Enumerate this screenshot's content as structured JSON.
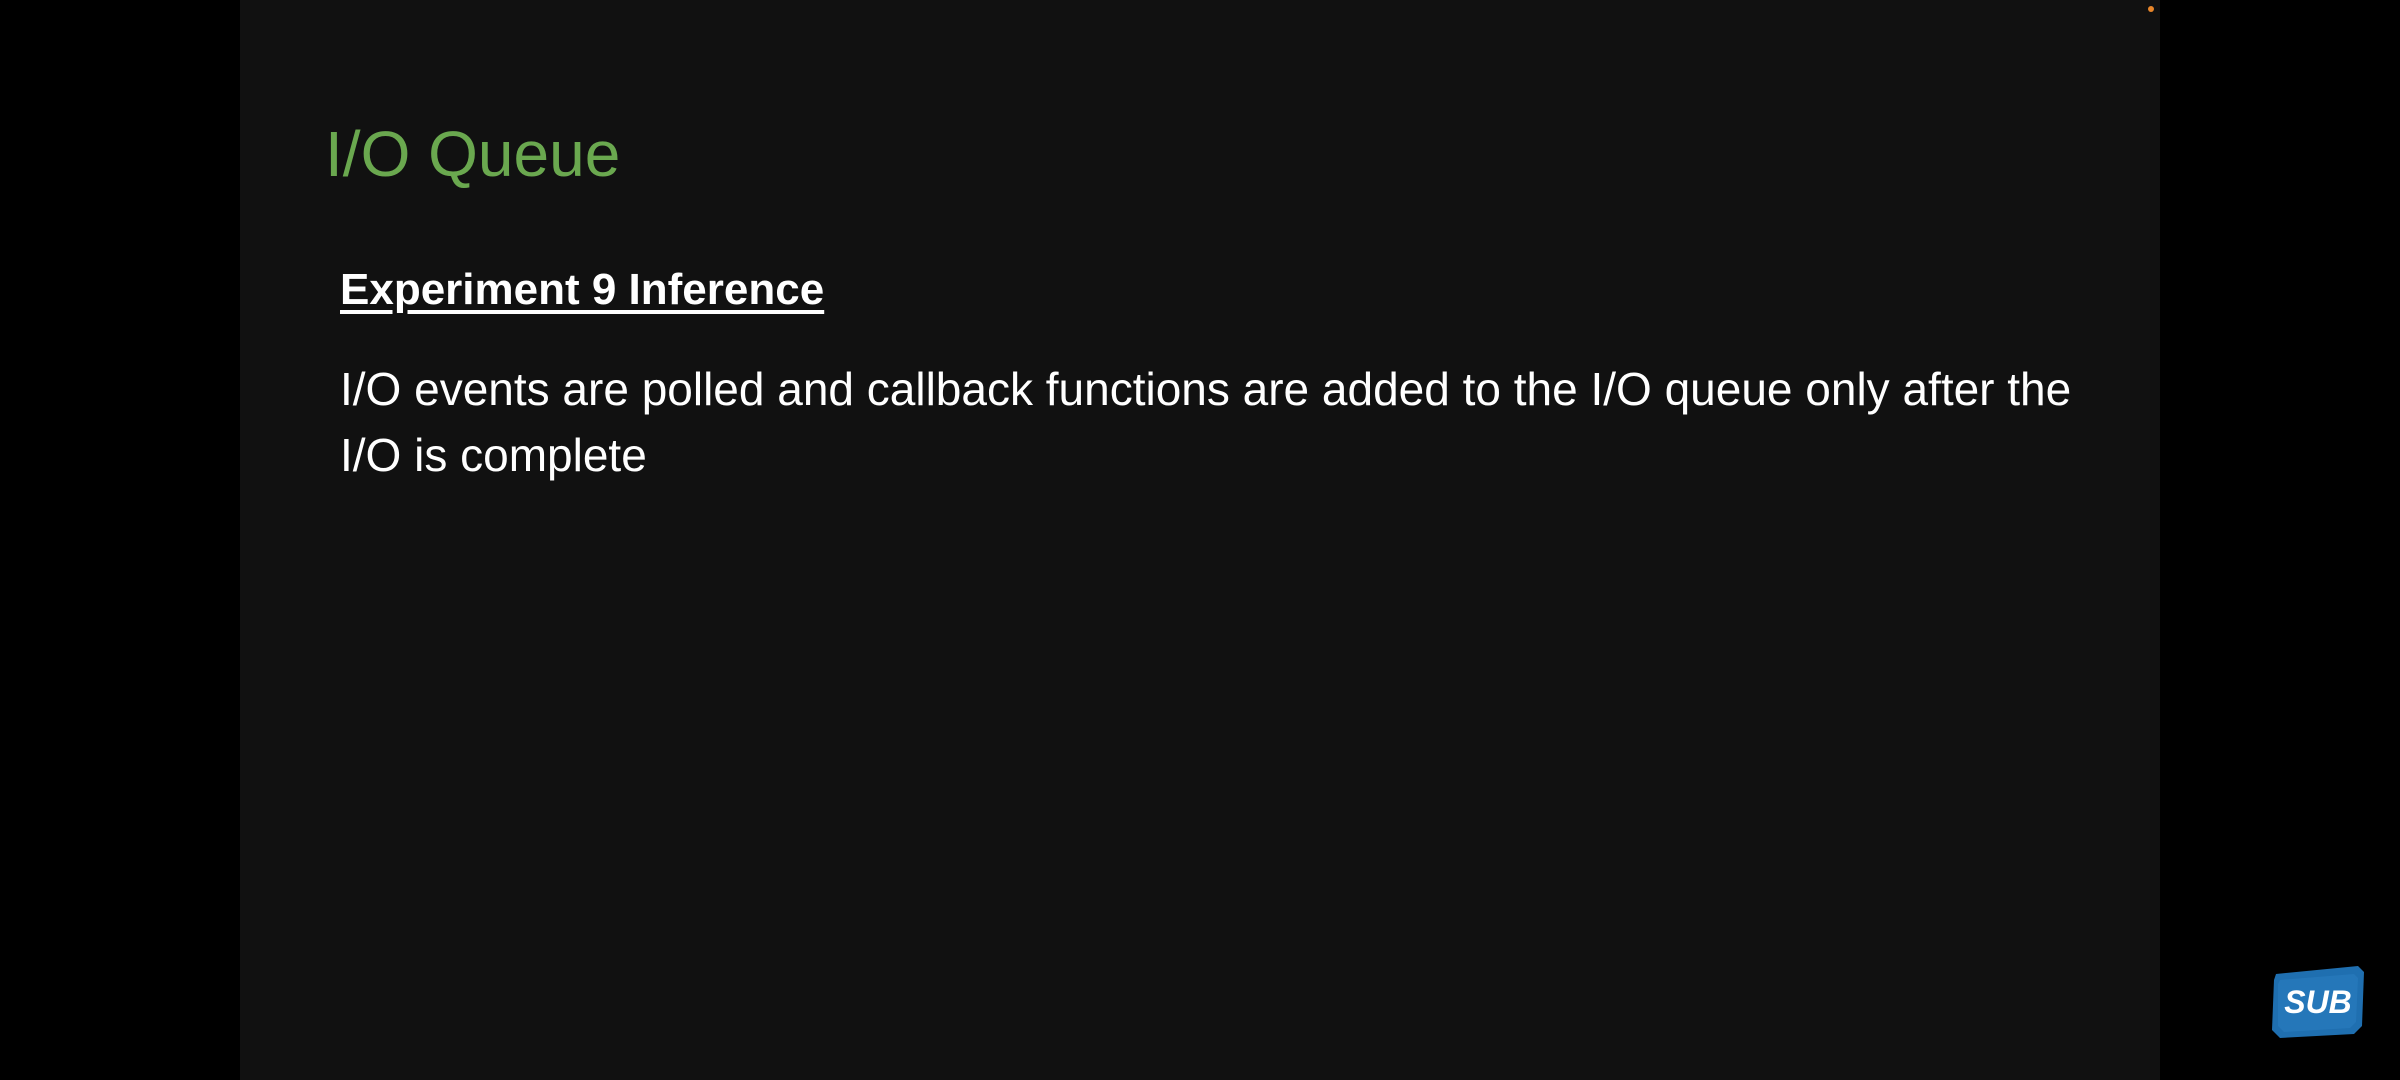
{
  "slide": {
    "title": "I/O Queue",
    "heading": "Experiment 9 Inference",
    "body": "I/O events are polled and callback functions are added to the I/O queue only after the I/O is complete"
  },
  "badge": {
    "label": "SUB",
    "icon": "subscribe-badge-icon"
  },
  "colors": {
    "title": "#6aa84f",
    "text": "#ffffff",
    "slide_background": "#111111",
    "letterbox": "#000000",
    "badge": "#1f6fb0",
    "dot": "#e8862a"
  }
}
